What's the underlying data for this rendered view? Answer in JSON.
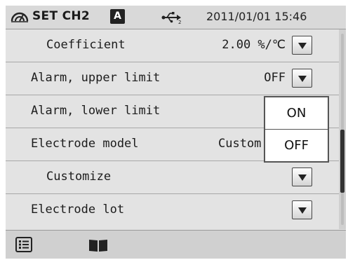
{
  "header": {
    "title": "SET CH2",
    "badge": "A",
    "datetime": "2011/01/01 15:46",
    "icons": [
      "sensor-icon",
      "usb-icon"
    ]
  },
  "settings": {
    "rows": [
      {
        "label": "Coefficient",
        "value": "2.00 %/℃",
        "indent": true,
        "has_dropdown": true
      },
      {
        "label": "Alarm, upper limit",
        "value": "OFF",
        "indent": false,
        "has_dropdown": true
      },
      {
        "label": "Alarm, lower limit",
        "value": "",
        "indent": false,
        "has_dropdown": false
      },
      {
        "label": "Electrode model",
        "value": "Custom",
        "indent": false,
        "has_dropdown": false
      },
      {
        "label": "Customize",
        "value": "",
        "indent": true,
        "has_dropdown": true
      },
      {
        "label": "Electrode lot",
        "value": "",
        "indent": false,
        "has_dropdown": true
      }
    ]
  },
  "popup": {
    "options": [
      "ON",
      "OFF"
    ]
  },
  "scroll": {
    "position": 0.75,
    "visible_fraction": 0.33
  },
  "footer": {
    "icons": [
      "menu-list-icon",
      "manual-book-icon"
    ]
  },
  "colors": {
    "background": "#e3e3e3",
    "header": "#d9d9d9",
    "text": "#1c1c1c",
    "scroll_thumb": "#333333"
  }
}
